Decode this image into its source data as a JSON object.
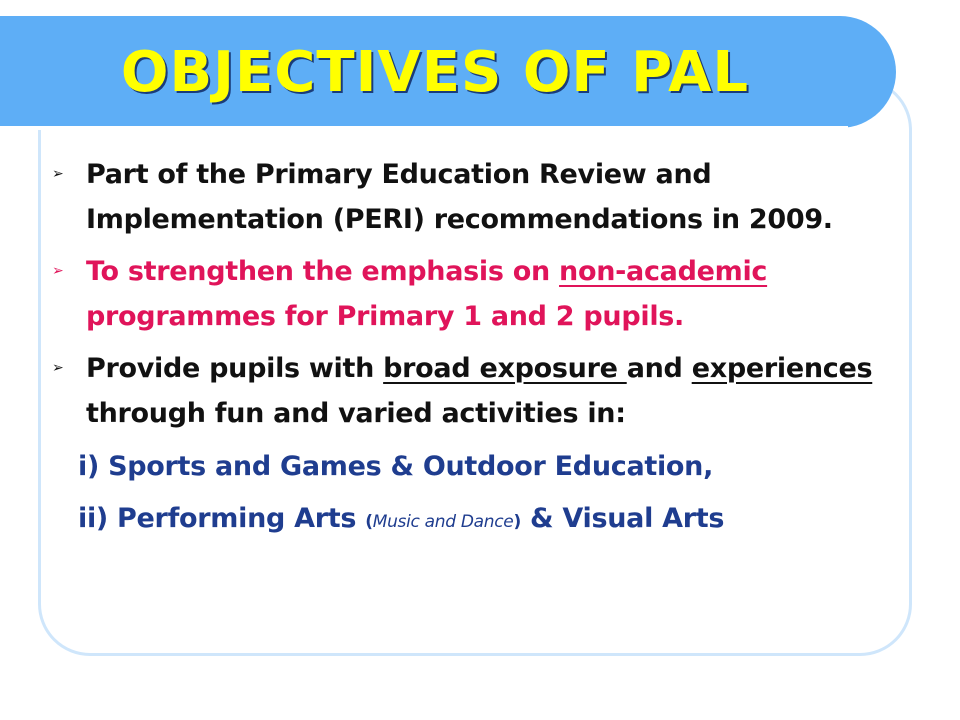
{
  "slide": {
    "title": "OBJECTIVES OF PAL",
    "bullets": {
      "b1": {
        "text": "Part of the Primary Education Review and Implementation (PERI) recommendations in 2009."
      },
      "b2": {
        "before": "To strengthen the emphasis on ",
        "underlined": "non-academic",
        "after": " programmes for Primary 1 and 2 pupils."
      },
      "b3": {
        "part1": "Provide pupils with ",
        "u1": "broad exposure ",
        "part2": "and ",
        "u2": "experiences",
        "part3": "  through fun and varied activities in:"
      }
    },
    "subitems": {
      "s1": "i) Sports and Games & Outdoor Education,",
      "s2": {
        "lead": "ii) Performing Arts ",
        "open": "(",
        "ital": "Music and Dance",
        "close": ")",
        "tail": " & Visual Arts"
      }
    },
    "bullet_glyph": "➢",
    "colors": {
      "title_bar": "#5eaef6",
      "title_text": "#ffff00",
      "frame": "#cfe6fb",
      "body_text": "#111111",
      "highlight_text": "#e0145a",
      "sub_text": "#1f3d8f"
    }
  }
}
